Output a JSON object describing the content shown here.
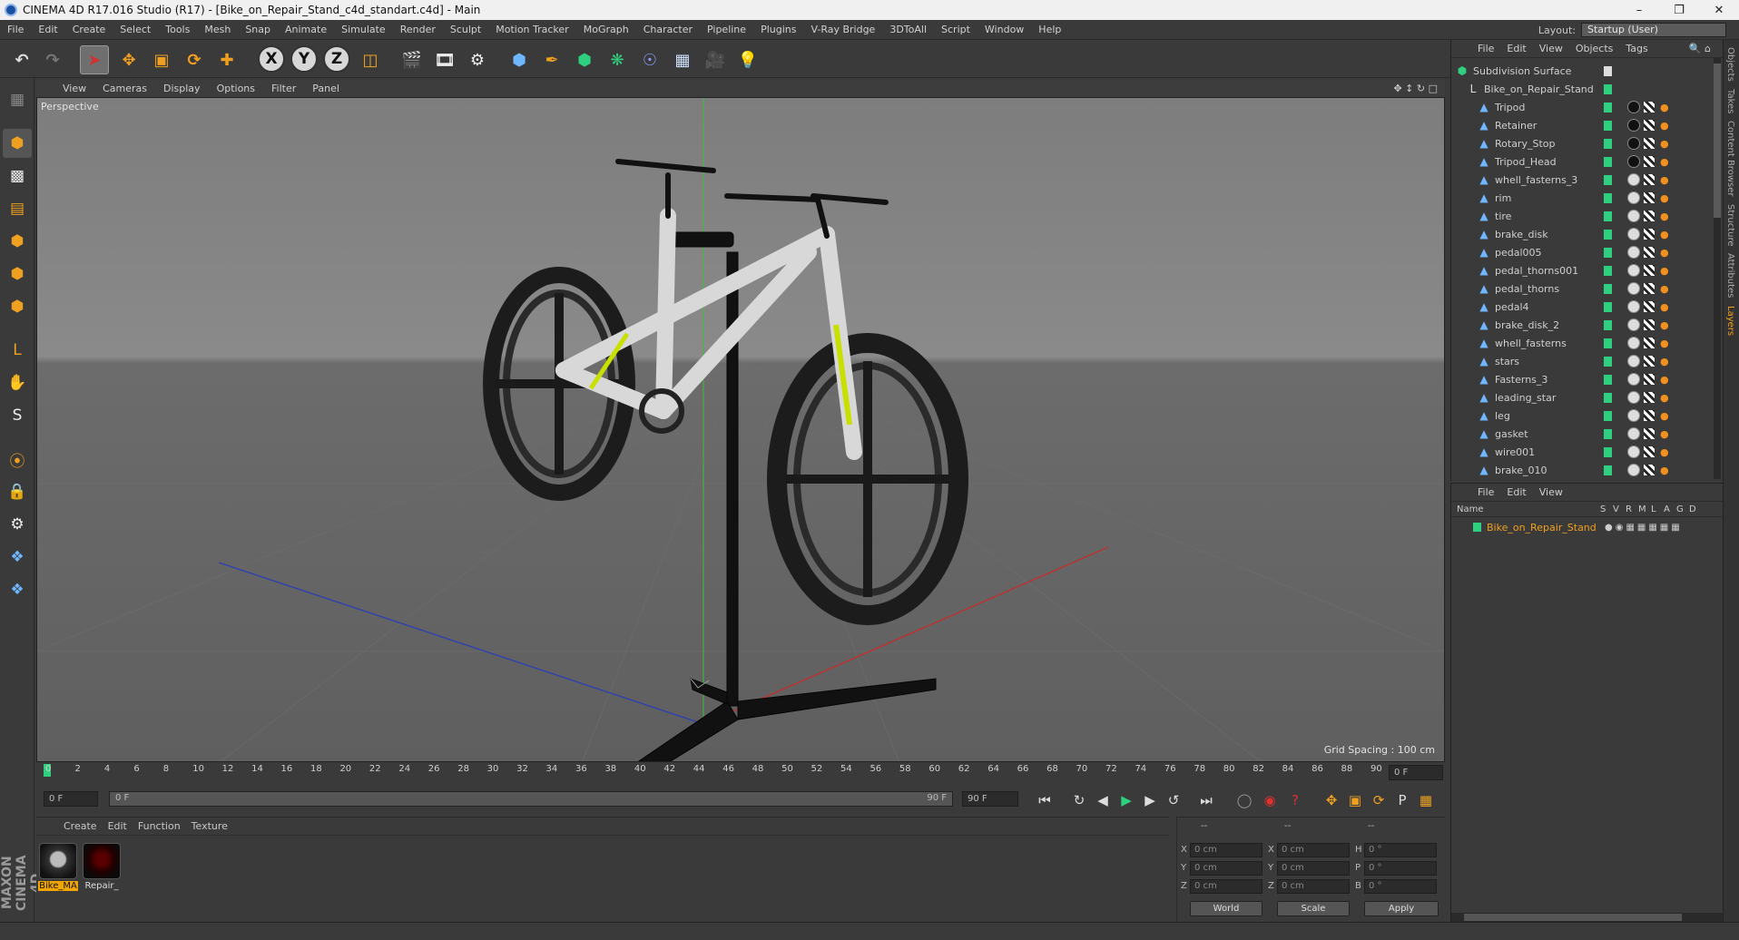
{
  "titlebar": {
    "title": "CINEMA 4D R17.016 Studio (R17) - [Bike_on_Repair_Stand_c4d_standart.c4d] - Main"
  },
  "menu": [
    "File",
    "Edit",
    "Create",
    "Select",
    "Tools",
    "Mesh",
    "Snap",
    "Animate",
    "Simulate",
    "Render",
    "Sculpt",
    "Motion Tracker",
    "MoGraph",
    "Character",
    "Pipeline",
    "Plugins",
    "V-Ray Bridge",
    "3DToAll",
    "Script",
    "Window",
    "Help"
  ],
  "layout": {
    "label": "Layout:",
    "value": "Startup (User)"
  },
  "viewport": {
    "menu": [
      "View",
      "Cameras",
      "Display",
      "Options",
      "Filter",
      "Panel"
    ],
    "label": "Perspective",
    "grid": "Grid Spacing : 100 cm"
  },
  "timeline": {
    "ticks": [
      "0",
      "2",
      "4",
      "6",
      "8",
      "10",
      "12",
      "14",
      "16",
      "18",
      "20",
      "22",
      "24",
      "26",
      "28",
      "30",
      "32",
      "34",
      "36",
      "38",
      "40",
      "42",
      "44",
      "46",
      "48",
      "50",
      "52",
      "54",
      "56",
      "58",
      "60",
      "62",
      "64",
      "66",
      "68",
      "70",
      "72",
      "74",
      "76",
      "78",
      "80",
      "82",
      "84",
      "86",
      "88",
      "90"
    ],
    "frame": "0 F",
    "start": "0 F",
    "range_start": "0 F",
    "range_end": "90 F",
    "end": "90 F"
  },
  "materials": {
    "menu": [
      "Create",
      "Edit",
      "Function",
      "Texture"
    ],
    "items": [
      {
        "name": "Bike_MA"
      },
      {
        "name": "Repair_"
      }
    ]
  },
  "coords": {
    "header": [
      "--",
      "--",
      "--"
    ],
    "rows": [
      {
        "a": "X",
        "v1": "0 cm",
        "b": "X",
        "v2": "0 cm",
        "c": "H",
        "v3": "0 °"
      },
      {
        "a": "Y",
        "v1": "0 cm",
        "b": "Y",
        "v2": "0 cm",
        "c": "P",
        "v3": "0 °"
      },
      {
        "a": "Z",
        "v1": "0 cm",
        "b": "Z",
        "v2": "0 cm",
        "c": "B",
        "v3": "0 °"
      }
    ],
    "world": "World",
    "scale": "Scale",
    "apply": "Apply"
  },
  "objects": {
    "menu": [
      "File",
      "Edit",
      "View",
      "Objects",
      "Tags"
    ],
    "root": "Subdivision Surface",
    "group": "Bike_on_Repair_Stand",
    "children": [
      "Tripod",
      "Retainer",
      "Rotary_Stop",
      "Tripod_Head",
      "whell_fasterns_3",
      "rim",
      "tire",
      "brake_disk",
      "pedal005",
      "pedal_thorns001",
      "pedal_thorns",
      "pedal4",
      "brake_disk_2",
      "whell_fasterns",
      "stars",
      "Fasterns_3",
      "leading_star",
      "leg",
      "gasket",
      "wire001",
      "brake_010"
    ]
  },
  "layers": {
    "menu": [
      "File",
      "Edit",
      "View"
    ],
    "header_name": "Name",
    "cols": [
      "S",
      "V",
      "R",
      "M",
      "L",
      "A",
      "G",
      "D"
    ],
    "row": "Bike_on_Repair_Stand"
  },
  "rtabs": [
    "Objects",
    "Takes",
    "Content Browser",
    "Structure",
    "Attributes",
    "Layers"
  ],
  "brand": "MAXON CINEMA 4D"
}
